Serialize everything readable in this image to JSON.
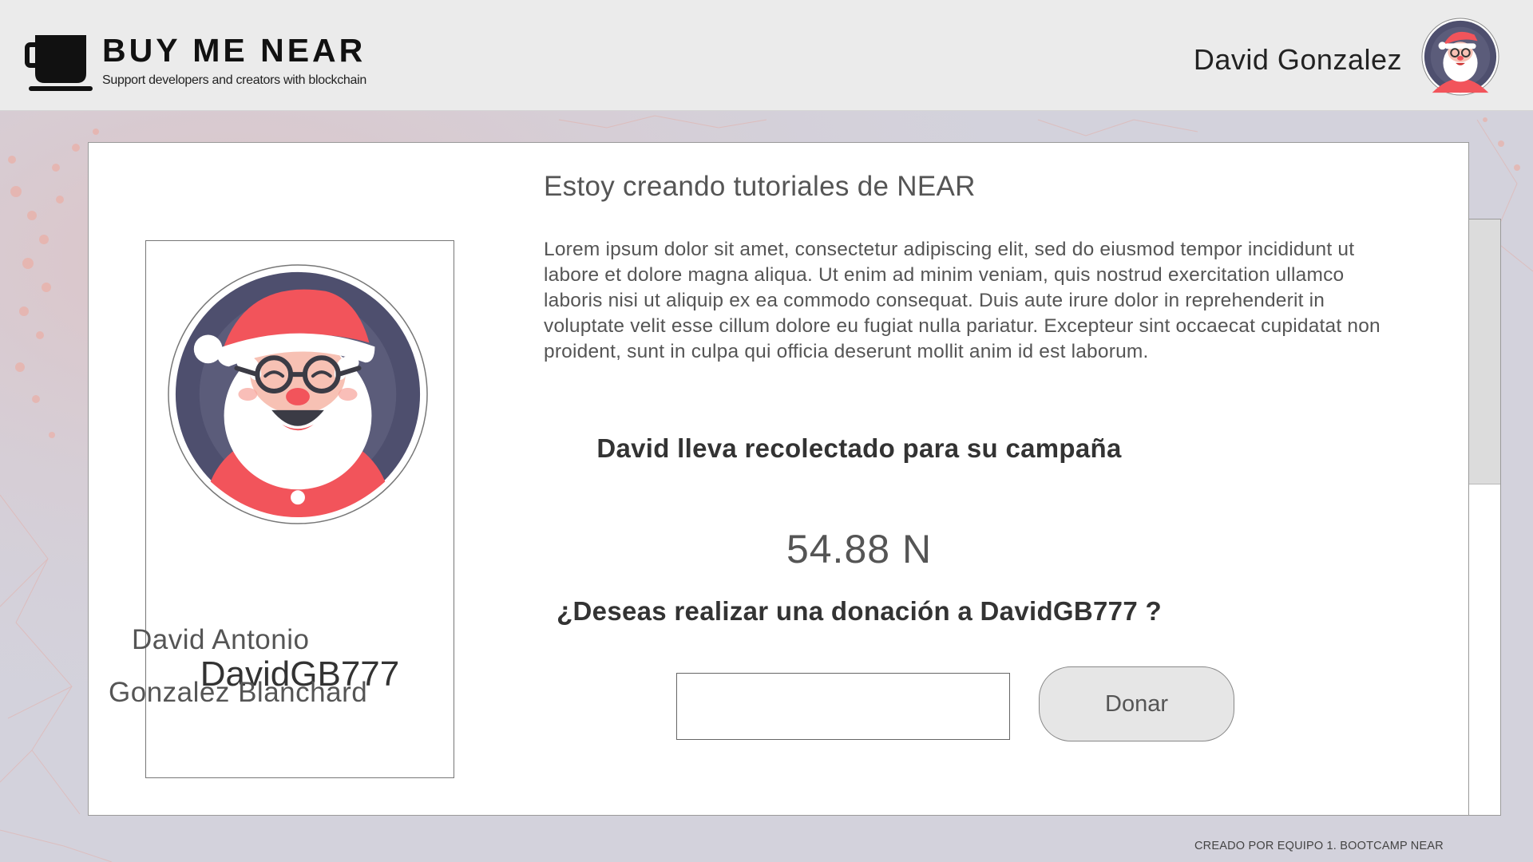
{
  "header": {
    "brand_title": "BUY ME NEAR",
    "brand_subtitle": "Support developers and creators with blockchain",
    "user_name": "David Gonzalez",
    "logo_icon": "coffee-cup-icon"
  },
  "profile": {
    "username": "DavidGB777",
    "name_line_1": "David Antonio",
    "name_line_2": "Gonzalez Blanchard",
    "avatar_icon": "santa-avatar"
  },
  "campaign": {
    "title": "Estoy creando tutoriales de NEAR",
    "description": "Lorem ipsum dolor sit amet, consectetur adipiscing elit, sed do eiusmod tempor incididunt ut labore et dolore magna aliqua. Ut enim ad minim veniam, quis nostrud exercitation ullamco laboris nisi ut aliquip ex ea commodo consequat. Duis aute irure dolor in reprehenderit in voluptate velit esse cillum dolore eu fugiat nulla pariatur. Excepteur sint occaecat cupidatat non proident, sunt in culpa qui officia deserunt mollit anim id est laborum.",
    "collected_label": "David lleva recolectado para su campaña",
    "collected_amount": "54.88 N",
    "donate_question": "¿Deseas realizar una donación a DavidGB777 ?",
    "donate_input_value": "",
    "donate_button_label": "Donar"
  },
  "footer": {
    "credit": "CREADO POR EQUIPO 1. BOOTCAMP NEAR"
  },
  "colors": {
    "header_bg": "#ebebeb",
    "page_bg": "#d3d2dc",
    "avatar_ring": "#4e4f6e",
    "santa_red": "#f2545b",
    "button_bg": "#e6e6e6"
  }
}
